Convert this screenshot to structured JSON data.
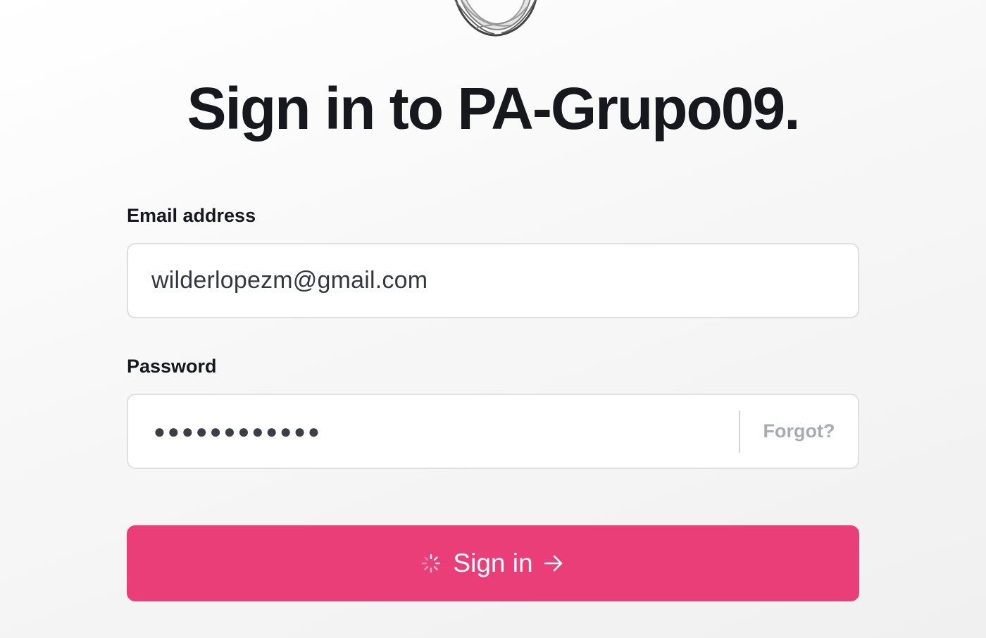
{
  "header": {
    "title": "Sign in to PA-Grupo09."
  },
  "form": {
    "email_label": "Email address",
    "email_value": "wilderlopezm@gmail.com",
    "password_label": "Password",
    "password_mask": "●●●●●●●●●●●●",
    "forgot_label": "Forgot?",
    "submit_label": "Sign in"
  },
  "icons": {
    "logo": "ring-logo-icon",
    "spinner": "loading-spinner-icon",
    "arrow": "arrow-right-icon"
  },
  "colors": {
    "accent": "#ea3e78",
    "text": "#16181d",
    "muted": "#a8abb3",
    "border": "#dedfe2"
  }
}
